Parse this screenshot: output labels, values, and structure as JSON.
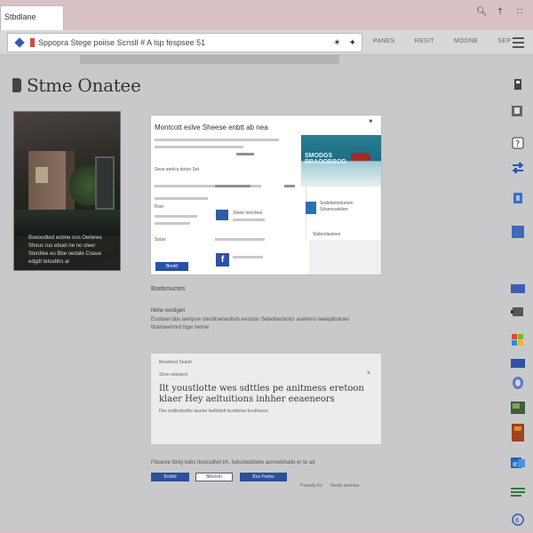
{
  "browser": {
    "tab_title": "Stbdlane",
    "url": "Sppopra    Stege poiise    Scnsll    #  A lsp    fespsee   51",
    "nav_links": [
      "PANES",
      "RESIT",
      "MODNE",
      "SEP"
    ],
    "window_controls": [
      "q",
      "r",
      "b"
    ]
  },
  "page": {
    "logo_text": "Stme Onatee",
    "hero_caption": "Boeoodted eobne nos Owleree Sheus ruo ebuel ne no oleer Sterdlee eu Bbe oedale Cnaue edgdt tetcebhs ar",
    "screenshot": {
      "title": "Montcott eslve   Sheese enbtt ab nea",
      "close": "■",
      "row_text_1": "Sese anelcs dotoo   Set",
      "row_text_2": "Stone ned ibes",
      "row_text_3": "Foer",
      "row_text_4": "Solan",
      "blue_button": "Bnefd",
      "beach_label": "SMODGS BBAOOBBOD",
      "side_text": "Sodedetnnkeiom Srlseonselden",
      "side_caption": "Slaboolastoes"
    },
    "section_label": "Bsebmuctes",
    "subhead": "Nkhe ovotlgen",
    "paragraph": "Esoboel bbs laenpoe stecbtsenesbuh eestsbs Sebelbecbolcr aselemo laelaplbutoes tlisetoeehnrd ttgw hetnie",
    "card": {
      "small_top": "Beeshoet Seaoh",
      "small_second": "Shoe esteaeol",
      "close": "×",
      "headline": "Ilt youstlotte wes sdttles pe anitmess eretoon klaer Hey aeltuitions inhher eeaeneors",
      "sub": "Fbe eotlitodwdhe lasehe leelbldelt bcedinioe bouthasoe"
    },
    "footer": {
      "text": "Fbsaree tbnly lelbs tlsoesdhel I/h, lsdssbeddelie aorreebhatlo er te ad",
      "btn_1": "Bnldtd",
      "btn_2": "Blbsnon",
      "btn_3": "Bos Peebs",
      "meta_1": "Pseaoly   Es",
      "meta_2": "Neetb eeehtes"
    }
  },
  "dock_icons": [
    "bookmark-icon",
    "translate-icon",
    "help-icon",
    "sliders-icon",
    "bolt-icon",
    "app-blue-icon",
    "card-blue-icon",
    "video-icon",
    "microsoft-icon",
    "flag-icon",
    "shield-icon",
    "image-icon",
    "book-icon",
    "outlook-icon",
    "excel-icon",
    "feedback-icon"
  ]
}
